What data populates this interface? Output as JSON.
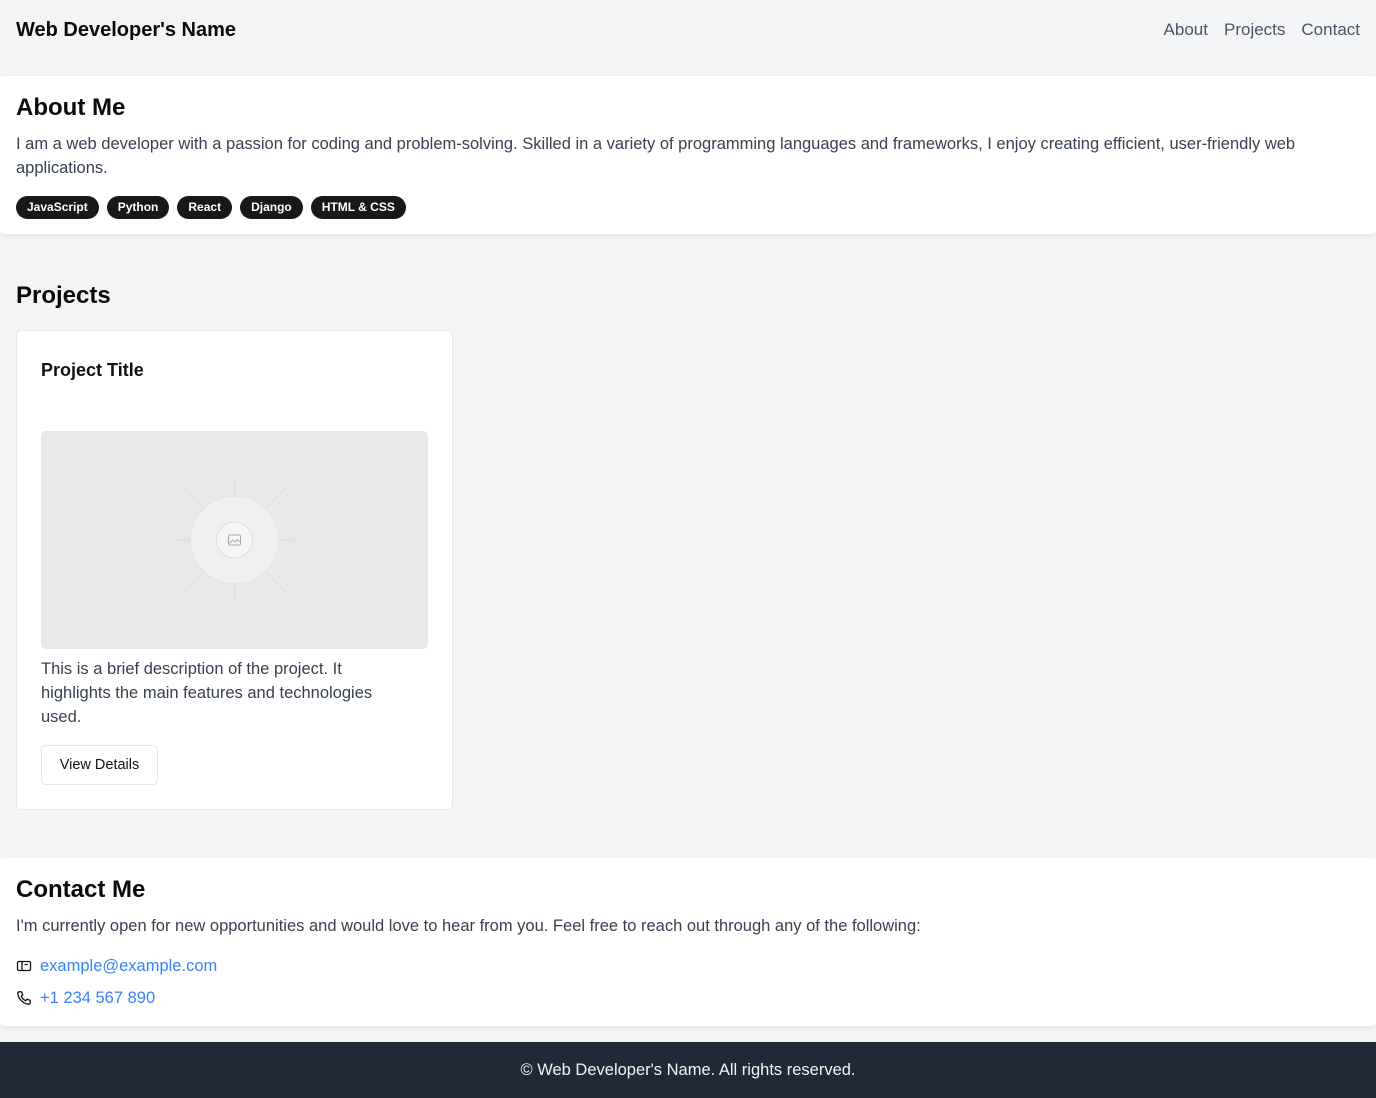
{
  "header": {
    "brand": "Web Developer's Name",
    "nav": [
      "About",
      "Projects",
      "Contact"
    ]
  },
  "about": {
    "heading": "About Me",
    "text": "I am a web developer with a passion for coding and problem-solving. Skilled in a variety of programming languages and frameworks, I enjoy creating efficient, user-friendly web applications.",
    "skills": [
      "JavaScript",
      "Python",
      "React",
      "Django",
      "HTML & CSS"
    ]
  },
  "projects": {
    "heading": "Projects",
    "items": [
      {
        "title": "Project Title",
        "image_icon": "image-placeholder-icon",
        "description": "This is a brief description of the project. It highlights the main features and technologies used.",
        "button_label": "View Details"
      }
    ]
  },
  "contact": {
    "heading": "Contact Me",
    "text": "I'm currently open for new opportunities and would love to hear from you. Feel free to reach out through any of the following:",
    "email": "example@example.com",
    "email_icon": "mail-icon",
    "phone": "+1 234 567 890",
    "phone_icon": "phone-icon"
  },
  "footer": {
    "text": "© Web Developer's Name. All rights reserved."
  },
  "colors": {
    "page_bg": "#f3f4f6",
    "footer_bg": "#1f2937",
    "link": "#3b82f6",
    "badge_bg": "#18181b"
  }
}
